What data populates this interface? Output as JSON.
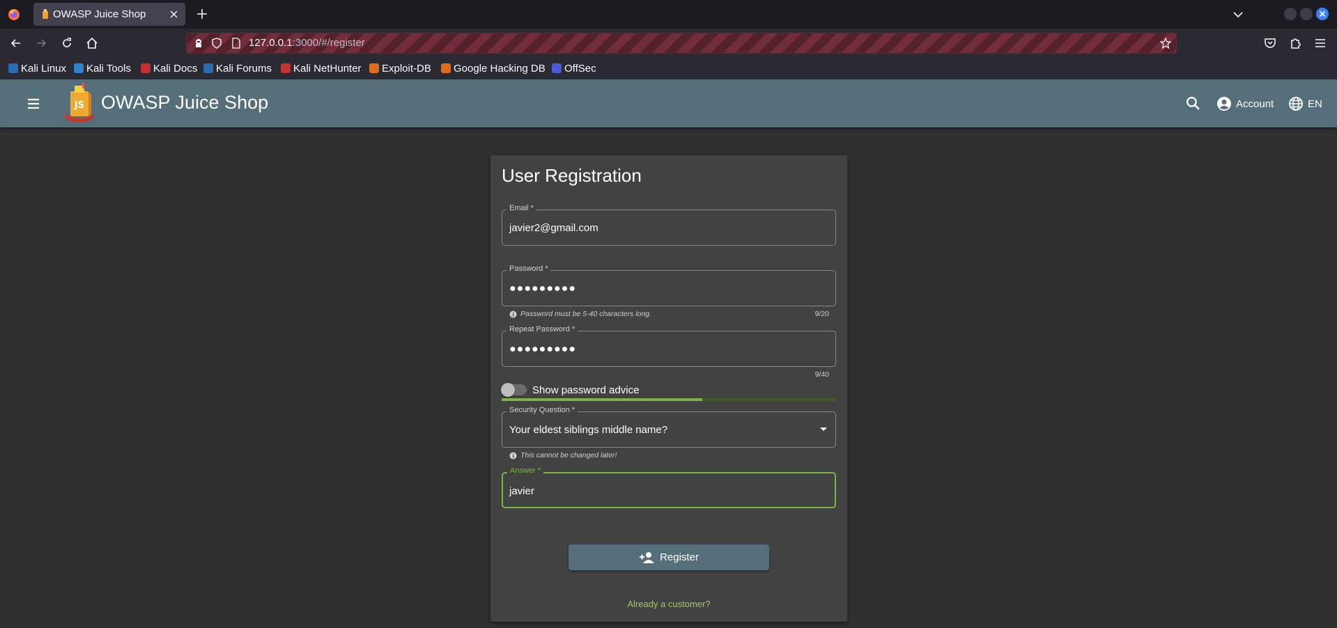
{
  "browser": {
    "tab_title": "OWASP Juice Shop",
    "url_host": "127.0.0.1",
    "url_rest": ":3000/#/register",
    "bookmarks": [
      {
        "label": "Kali Linux",
        "color": "#2b6cb0"
      },
      {
        "label": "Kali Tools",
        "color": "#3182ce"
      },
      {
        "label": "Kali Docs",
        "color": "#c53030"
      },
      {
        "label": "Kali Forums",
        "color": "#2b6cb0"
      },
      {
        "label": "Kali NetHunter",
        "color": "#c53030"
      },
      {
        "label": "Exploit-DB",
        "color": "#dd6b20"
      },
      {
        "label": "Google Hacking DB",
        "color": "#dd6b20"
      },
      {
        "label": "OffSec",
        "color": "#4a5cd6"
      }
    ]
  },
  "app": {
    "title": "OWASP Juice Shop",
    "account_label": "Account",
    "language_label": "EN",
    "toolbar_color": "#546e7a"
  },
  "form": {
    "title": "User Registration",
    "email": {
      "label": "Email *",
      "value": "javier2@gmail.com"
    },
    "password": {
      "label": "Password *",
      "value": "●●●●●●●●●",
      "hint": "Password must be 5-40 characters long.",
      "counter": "9/20"
    },
    "repeat_password": {
      "label": "Repeat Password *",
      "value": "●●●●●●●●●",
      "counter": "9/40"
    },
    "show_advice_label": "Show password advice",
    "password_strength": 0.6,
    "security_question": {
      "label": "Security Question *",
      "value": "Your eldest siblings middle name?",
      "hint": "This cannot be changed later!"
    },
    "answer": {
      "label": "Answer *",
      "value": "javier"
    },
    "register_label": "Register",
    "already_customer": "Already a customer?",
    "accent_color": "#7cb342"
  }
}
